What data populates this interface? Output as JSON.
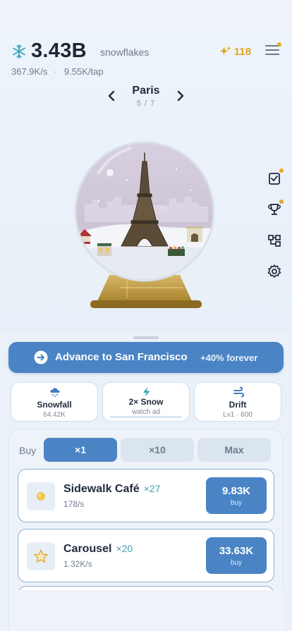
{
  "header": {
    "snowflakes": "3.43B",
    "snowflakes_unit": "snowflakes",
    "per_second": "367.9K/s",
    "separator": "·",
    "per_tap": "9.55K/tap",
    "sparkles": "118"
  },
  "city": {
    "name": "Paris",
    "page": "5 / 7"
  },
  "advance": {
    "label": "Advance to San Francisco",
    "bonus": "+40% forever"
  },
  "boosts": [
    {
      "title": "Snowfall",
      "sub": "64.42K",
      "icon": "cloud-snow-icon"
    },
    {
      "title": "2× Snow",
      "sub": "watch ad",
      "icon": "lightning-icon"
    },
    {
      "title": "Drift",
      "sub": "Lv1 · 600",
      "icon": "wind-icon"
    }
  ],
  "store": {
    "buy_label": "Buy",
    "multipliers": [
      "×1",
      "×10",
      "Max"
    ],
    "selected_multiplier": "×1",
    "items": [
      {
        "name": "Sidewalk Café",
        "count": "×27",
        "rate": "178/s",
        "price": "9.83K",
        "buy": "buy",
        "icon": "coffee-icon"
      },
      {
        "name": "Carousel",
        "count": "×20",
        "rate": "1.32K/s",
        "price": "33.63K",
        "buy": "buy",
        "icon": "star-icon"
      }
    ]
  },
  "colors": {
    "accent": "#4a84c4",
    "gold": "#e0a51f",
    "teal": "#3f9fb4",
    "background": "#eaf1f8"
  }
}
